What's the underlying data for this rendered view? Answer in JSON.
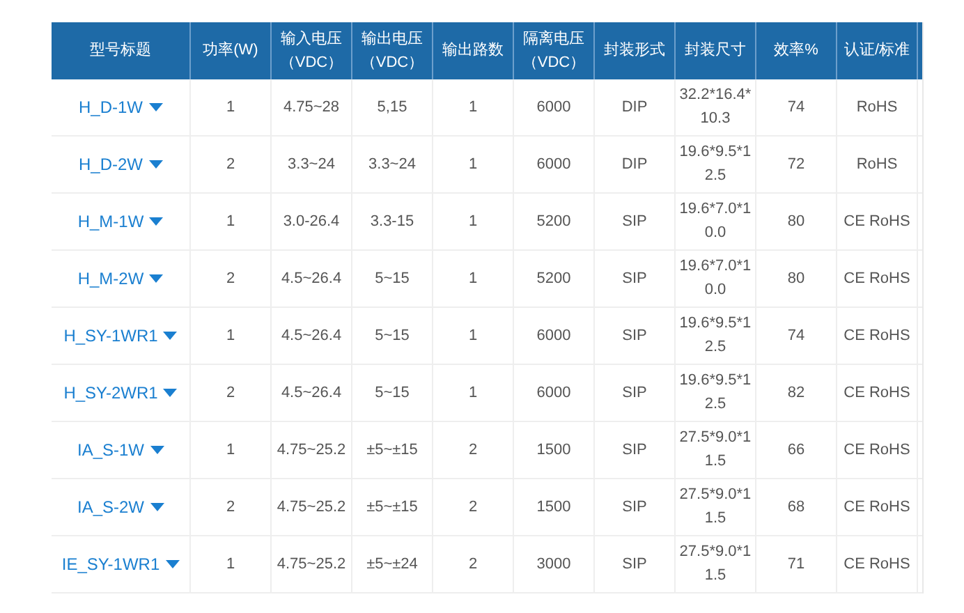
{
  "table": {
    "columns": [
      {
        "label": "型号标题"
      },
      {
        "label": "功率(W)"
      },
      {
        "label": "输入电压",
        "unit": "（VDC）"
      },
      {
        "label": "输出电压",
        "unit": "（VDC）"
      },
      {
        "label": "输出路数"
      },
      {
        "label": "隔离电压",
        "unit": "（VDC）"
      },
      {
        "label": "封装形式"
      },
      {
        "label": "封装尺寸"
      },
      {
        "label": "效率%"
      },
      {
        "label": "认证/标准"
      }
    ],
    "rows": [
      {
        "cells": [
          "H_D-1W",
          "1",
          "4.75~28",
          "5,15",
          "1",
          "6000",
          "DIP",
          "32.2*16.4*10.3",
          "74",
          "RoHS"
        ]
      },
      {
        "cells": [
          "H_D-2W",
          "2",
          "3.3~24",
          "3.3~24",
          "1",
          "6000",
          "DIP",
          "19.6*9.5*12.5",
          "72",
          "RoHS"
        ]
      },
      {
        "cells": [
          "H_M-1W",
          "1",
          "3.0-26.4",
          "3.3-15",
          "1",
          "5200",
          "SIP",
          "19.6*7.0*10.0",
          "80",
          "CE RoHS"
        ]
      },
      {
        "cells": [
          "H_M-2W",
          "2",
          "4.5~26.4",
          "5~15",
          "1",
          "5200",
          "SIP",
          "19.6*7.0*10.0",
          "80",
          "CE RoHS"
        ]
      },
      {
        "cells": [
          "H_SY-1WR1",
          "1",
          "4.5~26.4",
          "5~15",
          "1",
          "6000",
          "SIP",
          "19.6*9.5*12.5",
          "74",
          "CE RoHS"
        ]
      },
      {
        "cells": [
          "H_SY-2WR1",
          "2",
          "4.5~26.4",
          "5~15",
          "1",
          "6000",
          "SIP",
          "19.6*9.5*12.5",
          "82",
          "CE RoHS"
        ]
      },
      {
        "cells": [
          "IA_S-1W",
          "1",
          "4.75~25.2",
          "±5~±15",
          "2",
          "1500",
          "SIP",
          "27.5*9.0*11.5",
          "66",
          "CE RoHS"
        ]
      },
      {
        "cells": [
          "IA_S-2W",
          "2",
          "4.75~25.2",
          "±5~±15",
          "2",
          "1500",
          "SIP",
          "27.5*9.0*11.5",
          "68",
          "CE RoHS"
        ]
      },
      {
        "cells": [
          "IE_SY-1WR1",
          "1",
          "4.75~25.2",
          "±5~±24",
          "2",
          "3000",
          "SIP",
          "27.5*9.0*11.5",
          "71",
          "CE RoHS"
        ]
      }
    ]
  }
}
